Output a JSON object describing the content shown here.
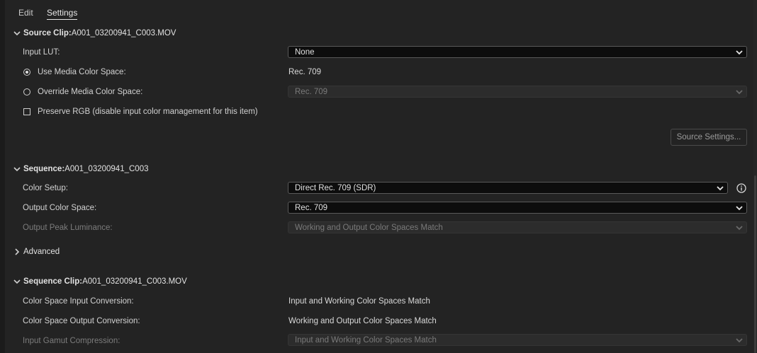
{
  "tabs": [
    {
      "label": "Edit",
      "active": false
    },
    {
      "label": "Settings",
      "active": true
    }
  ],
  "source_clip": {
    "header_bold": "Source Clip:",
    "header_name": " A001_03200941_C003.MOV",
    "input_lut": {
      "label": "Input LUT:",
      "value": "None"
    },
    "use_media": {
      "label": "Use Media Color Space:",
      "value": "Rec. 709",
      "checked": true
    },
    "override_media": {
      "label": "Override Media Color Space:",
      "value": "Rec. 709",
      "checked": false
    },
    "preserve_rgb": {
      "label": "Preserve RGB (disable input color management for this item)",
      "checked": false
    },
    "source_settings_button": "Source Settings..."
  },
  "sequence": {
    "header_bold": "Sequence:",
    "header_name": " A001_03200941_C003",
    "color_setup": {
      "label": "Color Setup:",
      "value": "Direct Rec. 709 (SDR)"
    },
    "output_color_space": {
      "label": "Output Color Space:",
      "value": "Rec. 709"
    },
    "output_peak_luminance": {
      "label": "Output Peak Luminance:",
      "value": "Working and Output Color Spaces Match"
    },
    "advanced_label": "Advanced"
  },
  "sequence_clip": {
    "header_bold": "Sequence Clip:",
    "header_name": " A001_03200941_C003.MOV",
    "input_conversion": {
      "label": "Color Space Input Conversion:",
      "value": "Input and Working Color Spaces Match"
    },
    "output_conversion": {
      "label": "Color Space Output Conversion:",
      "value": "Working and Output Color Spaces Match"
    },
    "gamut_compression": {
      "label": "Input Gamut Compression:",
      "value": "Input and Working Color Spaces Match"
    }
  },
  "icons": {
    "expanded": "chevron-down-icon",
    "collapsed": "chevron-right-icon",
    "dropdown": "chevron-down-icon",
    "info": "info-icon"
  },
  "colors": {
    "background": "#232323",
    "select_background": "#0d0d0d",
    "disabled_text": "#7a7a7a"
  }
}
